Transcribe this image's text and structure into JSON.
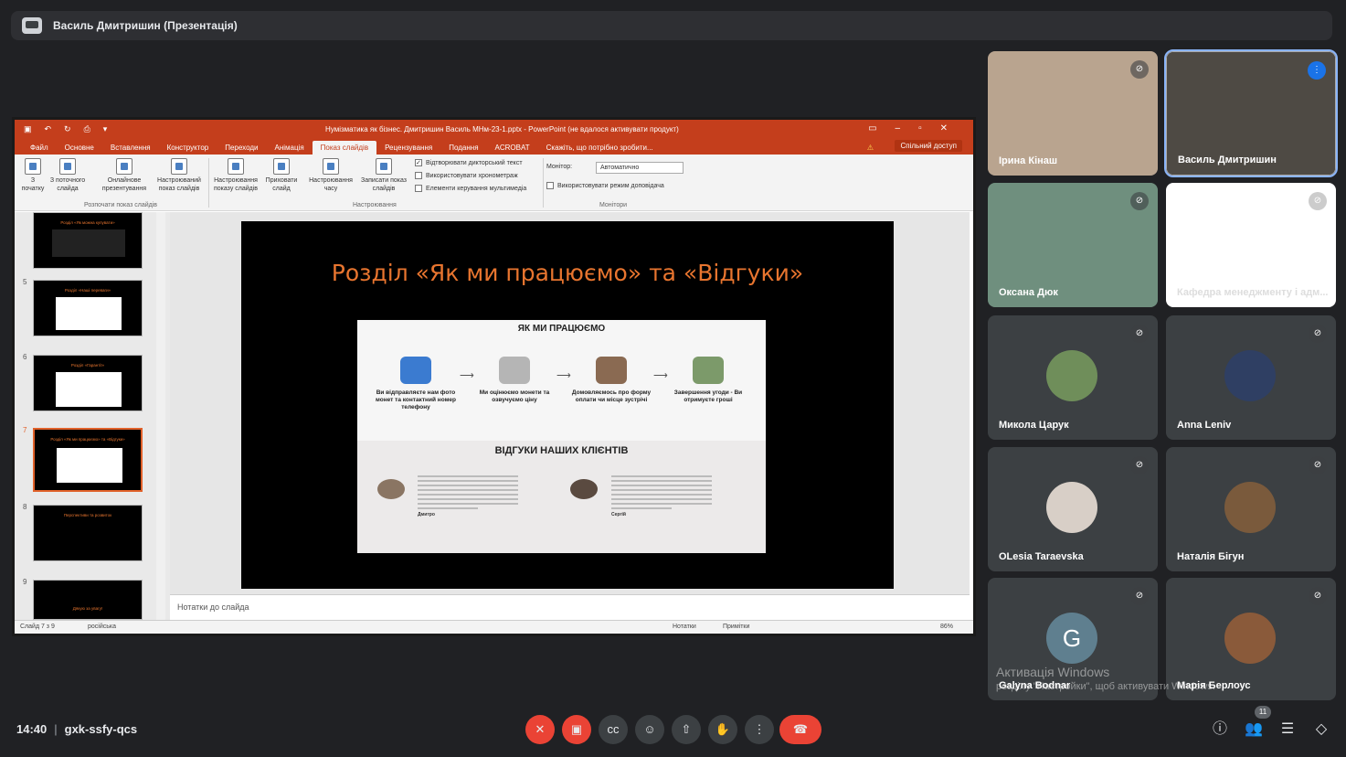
{
  "meet": {
    "top_title": "Василь Дмитришин (Презентація)",
    "time": "14:40",
    "code": "gxk-ssfy-qcs",
    "participants_count": "11",
    "watermark_line1": "Активація Windows",
    "watermark_line2": "розділу \"Настройки\", щоб активувати Windows."
  },
  "ppt": {
    "window_title": "Нумізматика як бізнес. Дмитришин Василь МНм-23-1.pptx - PowerPoint (не вдалося активувати продукт)",
    "tabs": [
      "Файл",
      "Основне",
      "Вставлення",
      "Конструктор",
      "Переходи",
      "Анімація",
      "Показ слайдів",
      "Рецензування",
      "Подання",
      "ACROBAT"
    ],
    "tell_me": "Скажіть, що потрібно зробити...",
    "share": "Спільний доступ",
    "ribbon": {
      "btn_from_start": "З початку",
      "btn_from_current": "З поточного слайда",
      "btn_online": "Онлайнове презентування",
      "btn_custom": "Настроюваний показ слайдів",
      "group_start": "Розпочати показ слайдів",
      "btn_setup": "Настроювання показу слайдів",
      "btn_hide": "Приховати слайд",
      "btn_timing": "Настроювання часу",
      "btn_record": "Записати показ слайдів",
      "chk_narration": "Відтворювати дикторський текст",
      "chk_timings": "Використовувати хронометраж",
      "chk_media": "Елементи керування мультимедіа",
      "group_setup": "Настроювання",
      "monitor_label": "Монітор:",
      "monitor_value": "Автоматично",
      "chk_presenter": "Використовувати режим доповідача",
      "group_monitors": "Монітори"
    },
    "thumbs": [
      {
        "num": "",
        "title": "Розділ «Як можна купувати»"
      },
      {
        "num": "5",
        "title": "Розділ «Наші переваги»"
      },
      {
        "num": "6",
        "title": "Розділ «Гарантії»"
      },
      {
        "num": "7",
        "title": "Розділ «Як ми працюємо» та «Відгуки»"
      },
      {
        "num": "8",
        "title": "Перспективи та розвиток"
      },
      {
        "num": "9",
        "title": "Дякую за увагу!"
      }
    ],
    "slide": {
      "title": "Розділ «Як ми працюємо» та «Відгуки»",
      "how_heading": "ЯК МИ ПРАЦЮЄМО",
      "steps": [
        "Ви відправляєте нам фото монет та контактний номер телефону",
        "Ми оцінюємо монети та озвучуємо ціну",
        "Домовляємось про форму оплати чи місце зустрічі",
        "Завершення угоди - Ви отримуєте гроші"
      ],
      "reviews_heading": "ВІДГУКИ НАШИХ КЛІЄНТІВ",
      "reviewer1": "Дмитро",
      "reviewer2": "Сергій"
    },
    "notes_placeholder": "Нотатки до слайда",
    "status_slide": "Слайд 7 з 9",
    "status_lang": "російська",
    "status_notes": "Нотатки",
    "status_comments": "Примітки",
    "zoom": "86%"
  },
  "participants": [
    {
      "name": "Ірина Кінаш",
      "color": "#b9a48f",
      "muted": true
    },
    {
      "name": "Василь Дмитришин",
      "color": "#4e4a44",
      "muted": false
    },
    {
      "name": "Оксана Дюк",
      "color": "#6f8f7e",
      "muted": true
    },
    {
      "name": "Кафедра менеджменту і адм...",
      "color": "#ffffff",
      "muted": true
    },
    {
      "name": "Микола Царук",
      "color": "#6f8e5a",
      "muted": true
    },
    {
      "name": "Anna Leniv",
      "color": "#2f3f63",
      "muted": true
    },
    {
      "name": "OLesia Taraevska",
      "color": "#d8cfc7",
      "muted": true
    },
    {
      "name": "Наталія Бігун",
      "color": "#7a5a3c",
      "muted": true
    },
    {
      "name": "Galyna Bodnar",
      "initial": "G",
      "color": "#5f7f8f",
      "muted": true
    },
    {
      "name": "Марія Берлоус",
      "color": "#8a5a3a",
      "muted": true
    }
  ]
}
